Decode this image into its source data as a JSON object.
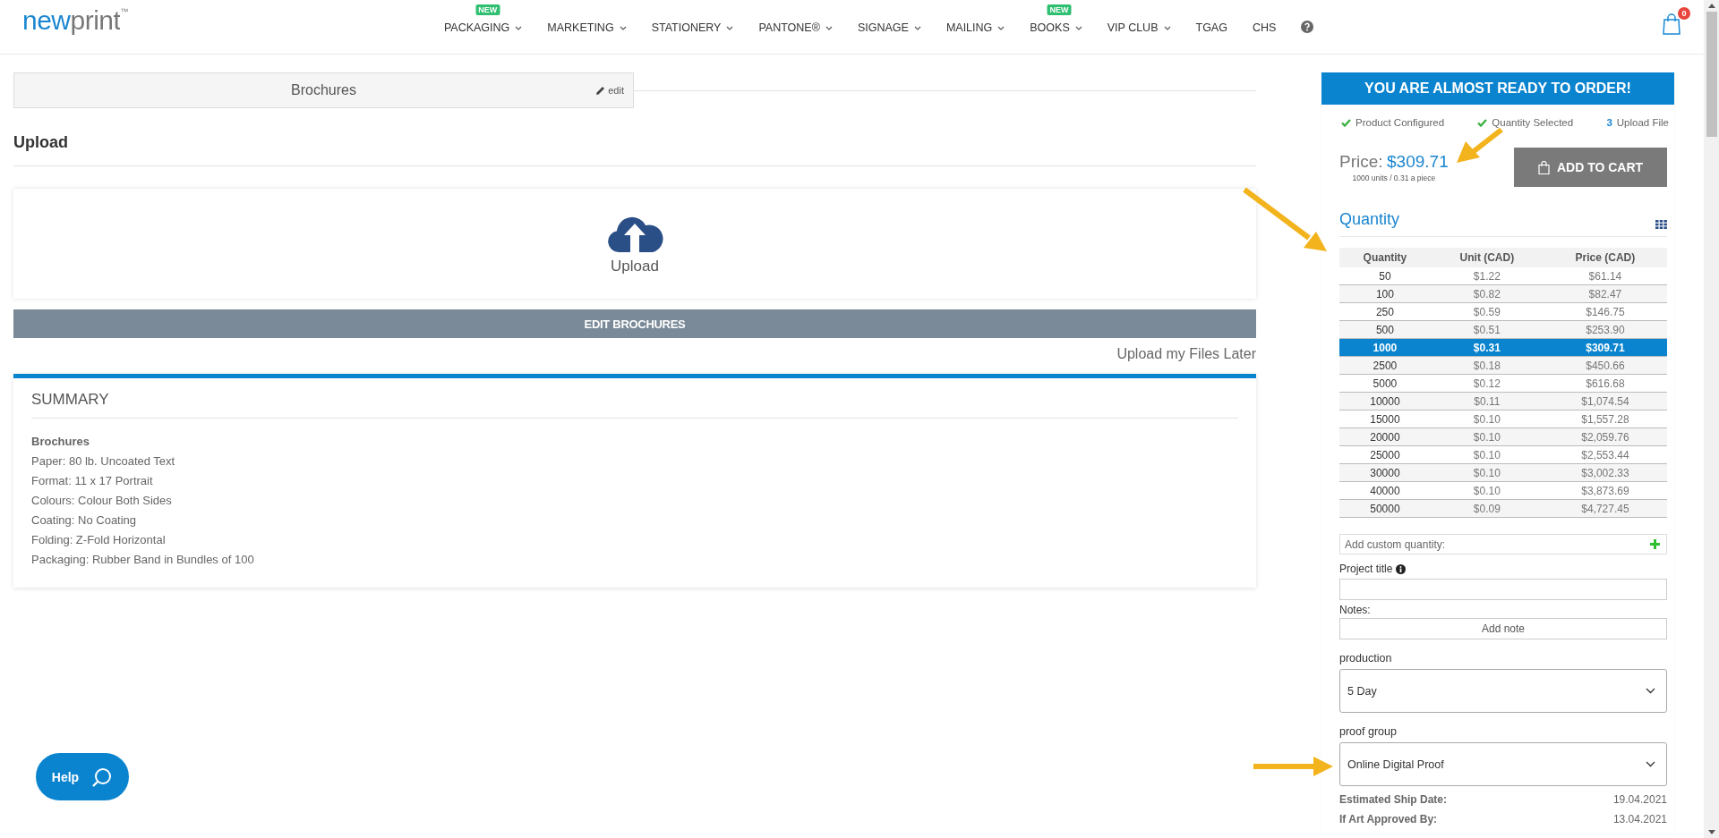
{
  "header": {
    "logo": {
      "text": "newprint",
      "trademark": "™"
    },
    "nav": [
      {
        "label": "PACKAGING",
        "dropdown": true,
        "badge": "NEW"
      },
      {
        "label": "MARKETING",
        "dropdown": true
      },
      {
        "label": "STATIONERY",
        "dropdown": true
      },
      {
        "label": "PANTONE®",
        "dropdown": true
      },
      {
        "label": "SIGNAGE",
        "dropdown": true
      },
      {
        "label": "MAILING",
        "dropdown": true
      },
      {
        "label": "BOOKS",
        "dropdown": true,
        "badge": "NEW"
      },
      {
        "label": "VIP CLUB",
        "dropdown": true
      },
      {
        "label": "TGAG",
        "dropdown": false
      },
      {
        "label": "CHS",
        "dropdown": false
      }
    ],
    "cart_count": "0"
  },
  "product_bar": {
    "title": "Brochures",
    "edit": "edit"
  },
  "upload_section": {
    "heading": "Upload",
    "dropzone_label": "Upload",
    "edit_button": "EDIT BROCHURES",
    "later_link": "Upload my Files Later"
  },
  "summary": {
    "title": "SUMMARY",
    "product": "Brochures",
    "lines": [
      "Paper: 80 lb. Uncoated Text",
      "Format: 11 x 17 Portrait",
      "Colours: Colour Both Sides",
      "Coating: No Coating",
      "Folding: Z-Fold Horizontal",
      "Packaging: Rubber Band in Bundles of 100"
    ]
  },
  "order_panel": {
    "banner": "YOU ARE ALMOST READY TO ORDER!",
    "steps": [
      {
        "label": "Product Configured",
        "kind": "done"
      },
      {
        "label": "Quantity Selected",
        "kind": "done"
      },
      {
        "label": "Upload File",
        "kind": "number",
        "number": "3"
      }
    ],
    "price_label": "Price:",
    "price": "$309.71",
    "price_note": "1000 units / 0.31 a piece",
    "add_to_cart": "ADD TO CART",
    "quantity_heading": "Quantity",
    "table": {
      "columns": [
        "Quantity",
        "Unit (CAD)",
        "Price (CAD)"
      ],
      "rows": [
        {
          "cells": [
            "50",
            "$1.22",
            "$61.14"
          ],
          "selected": false
        },
        {
          "cells": [
            "100",
            "$0.82",
            "$82.47"
          ],
          "selected": false
        },
        {
          "cells": [
            "250",
            "$0.59",
            "$146.75"
          ],
          "selected": false
        },
        {
          "cells": [
            "500",
            "$0.51",
            "$253.90"
          ],
          "selected": false
        },
        {
          "cells": [
            "1000",
            "$0.31",
            "$309.71"
          ],
          "selected": true
        },
        {
          "cells": [
            "2500",
            "$0.18",
            "$450.66"
          ],
          "selected": false
        },
        {
          "cells": [
            "5000",
            "$0.12",
            "$616.68"
          ],
          "selected": false
        },
        {
          "cells": [
            "10000",
            "$0.11",
            "$1,074.54"
          ],
          "selected": false
        },
        {
          "cells": [
            "15000",
            "$0.10",
            "$1,557.28"
          ],
          "selected": false
        },
        {
          "cells": [
            "20000",
            "$0.10",
            "$2,059.76"
          ],
          "selected": false
        },
        {
          "cells": [
            "25000",
            "$0.10",
            "$2,553.44"
          ],
          "selected": false
        },
        {
          "cells": [
            "30000",
            "$0.10",
            "$3,002.33"
          ],
          "selected": false
        },
        {
          "cells": [
            "40000",
            "$0.10",
            "$3,873.69"
          ],
          "selected": false
        },
        {
          "cells": [
            "50000",
            "$0.09",
            "$4,727.45"
          ],
          "selected": false
        }
      ]
    },
    "custom_quantity": {
      "placeholder": "Add custom quantity:"
    },
    "project_title": {
      "label": "Project title"
    },
    "notes": {
      "label": "Notes:",
      "button": "Add note"
    },
    "production": {
      "label": "production",
      "value": "5 Day"
    },
    "proof_group": {
      "label": "proof group",
      "value": "Online Digital Proof"
    },
    "ship": [
      {
        "label": "Estimated Ship Date:",
        "value": "19.04.2021"
      },
      {
        "label": "If Art Approved By:",
        "value": "13.04.2021"
      }
    ]
  },
  "help_button": {
    "label": "Help"
  }
}
